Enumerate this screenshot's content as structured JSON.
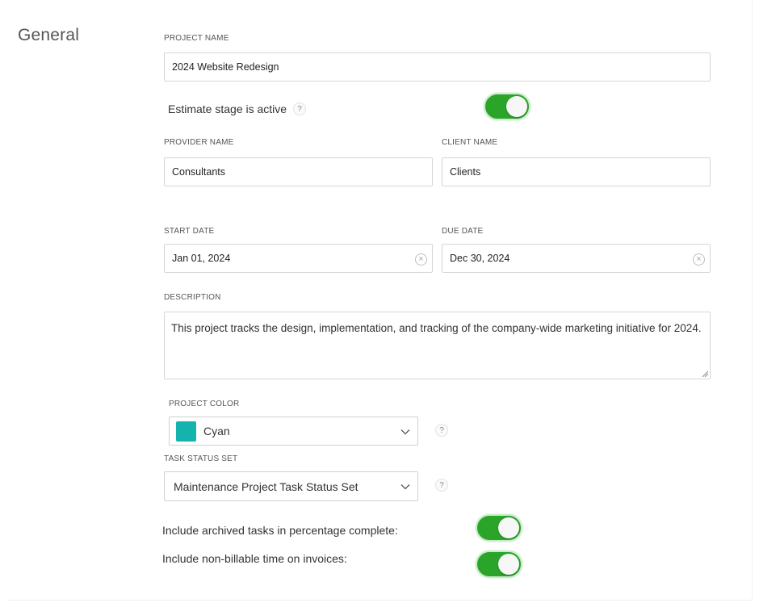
{
  "section": {
    "title": "General"
  },
  "project_name": {
    "label": "PROJECT NAME",
    "value": "2024 Website Redesign"
  },
  "estimate_stage": {
    "label": "Estimate stage is active",
    "help": "?",
    "enabled": true
  },
  "provider": {
    "label": "PROVIDER NAME",
    "value": "Consultants"
  },
  "client": {
    "label": "CLIENT NAME",
    "value": "Clients"
  },
  "start_date": {
    "label": "START DATE",
    "value": "Jan 01, 2024",
    "clear": "×"
  },
  "due_date": {
    "label": "DUE DATE",
    "value": "Dec 30, 2024",
    "clear": "×"
  },
  "description": {
    "label": "DESCRIPTION",
    "value": "This project tracks the design, implementation, and tracking of the company-wide marketing initiative for 2024."
  },
  "project_color": {
    "label": "PROJECT COLOR",
    "value": "Cyan",
    "swatch": "#14b3ae",
    "help": "?"
  },
  "task_status_set": {
    "label": "TASK STATUS SET",
    "value": "Maintenance Project Task Status Set",
    "help": "?"
  },
  "archived_tasks": {
    "label": "Include archived tasks in percentage complete:",
    "enabled": true
  },
  "non_billable": {
    "label": "Include non-billable time on invoices:",
    "enabled": true
  },
  "colors": {
    "toggle_on": "#2aa52a"
  }
}
